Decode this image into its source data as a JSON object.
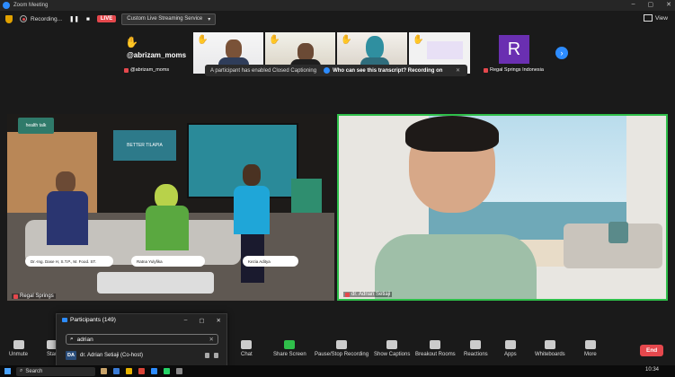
{
  "window": {
    "title": "Zoom Meeting"
  },
  "infobar": {
    "recording_label": "Recording...",
    "live_label": "LIVE",
    "stream_service": "Custom Live Streaming Service",
    "view_label": "View"
  },
  "thumbnails": [
    {
      "name": "@abrizam_moms",
      "big_text": "@abrizam_moms"
    },
    {
      "name": "Regal Springs Indonesia",
      "avatar_letter": "R"
    }
  ],
  "cc_banner": {
    "text": "A participant has enabled Closed Captioning",
    "link": "Who can see this transcript? Recording on"
  },
  "main_video": {
    "left_label": "Regal Springs",
    "right_label": "dr. Adrian Setiaji",
    "show_logo": "health talk",
    "backdrop_text": "BETTER TILAPIA",
    "lower_thirds": [
      "Dr.-Ing. Dase H, S.T.P., M. Food. ST.",
      "Ratna Yulyfika",
      "Kezia Aditya"
    ]
  },
  "toolbar": {
    "unmute": "Unmute",
    "start_video": "Start",
    "chat": "Chat",
    "share_screen": "Share Screen",
    "pause_recording": "Pause/Stop Recording",
    "show_captions": "Show Captions",
    "breakout_rooms": "Breakout Rooms",
    "reactions": "Reactions",
    "apps": "Apps",
    "whiteboards": "Whiteboards",
    "more": "More",
    "end": "End"
  },
  "participants_panel": {
    "title": "Participants (149)",
    "search_value": "adrian",
    "rows": [
      {
        "initials": "DA",
        "name": "dr. Adrian Setiaji (Co-host)"
      }
    ]
  },
  "taskbar": {
    "search_label": "Search",
    "clock": "10:34"
  },
  "colors": {
    "accent": "#2d8cff",
    "live": "#e5484d",
    "share": "#2fbf4a"
  }
}
